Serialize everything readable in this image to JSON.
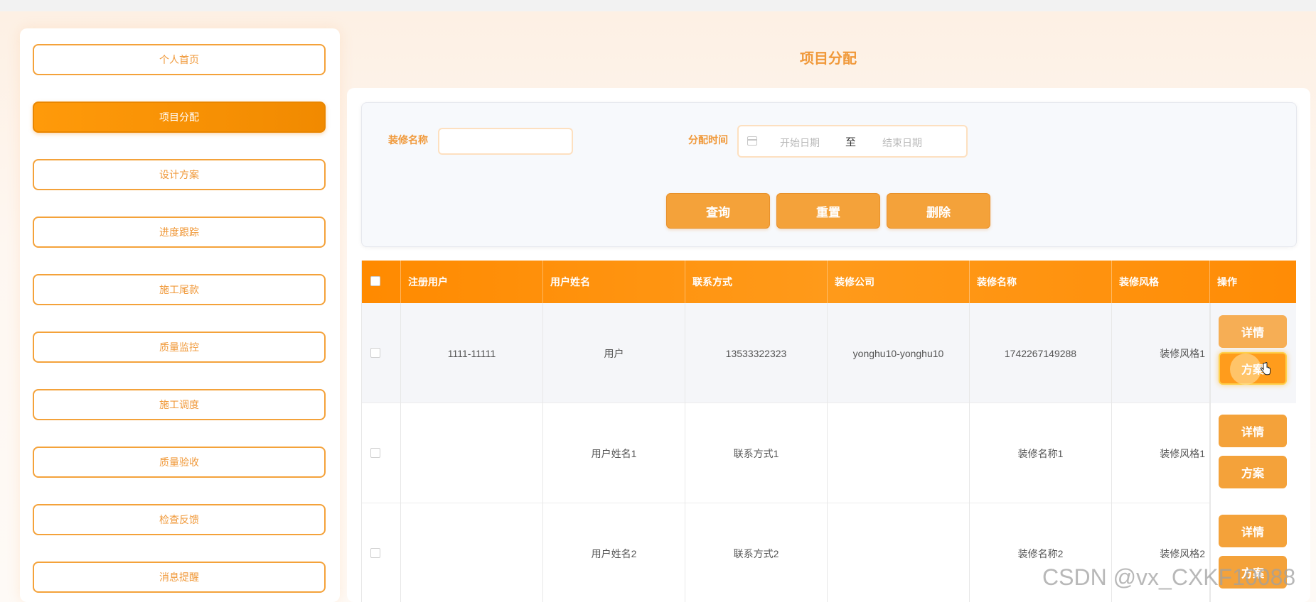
{
  "sidebar": {
    "items": [
      {
        "label": "个人首页"
      },
      {
        "label": "项目分配"
      },
      {
        "label": "设计方案"
      },
      {
        "label": "进度跟踪"
      },
      {
        "label": "施工尾款"
      },
      {
        "label": "质量监控"
      },
      {
        "label": "施工调度"
      },
      {
        "label": "质量验收"
      },
      {
        "label": "检查反馈"
      },
      {
        "label": "消息提醒"
      }
    ],
    "active_index": 1
  },
  "page": {
    "title": "项目分配"
  },
  "search": {
    "name_label": "装修名称",
    "name_value": "",
    "time_label": "分配时间",
    "start_placeholder": "开始日期",
    "separator": "至",
    "end_placeholder": "结束日期",
    "query_button": "查询",
    "reset_button": "重置",
    "delete_button": "删除"
  },
  "table": {
    "columns": [
      "注册用户",
      "用户姓名",
      "联系方式",
      "装修公司",
      "装修名称",
      "装修风格",
      "操作"
    ],
    "rows": [
      {
        "user": "1111-11111",
        "name": "用户",
        "contact": "13533322323",
        "company": "yonghu10-yonghu10",
        "project": "1742267149288",
        "style": "装修风格1",
        "detail": "详情",
        "plan": "方案"
      },
      {
        "user": "",
        "name": "用户姓名1",
        "contact": "联系方式1",
        "company": "",
        "project": "装修名称1",
        "style": "装修风格1",
        "detail": "详情",
        "plan": "方案"
      },
      {
        "user": "",
        "name": "用户姓名2",
        "contact": "联系方式2",
        "company": "",
        "project": "装修名称2",
        "style": "装修风格2",
        "detail": "详情",
        "plan": "方案"
      }
    ]
  },
  "watermark": "CSDN @vx_CXKF10088",
  "colors": {
    "accent": "#f4a23a",
    "header": "#ff8a00",
    "label": "#f0993a"
  }
}
